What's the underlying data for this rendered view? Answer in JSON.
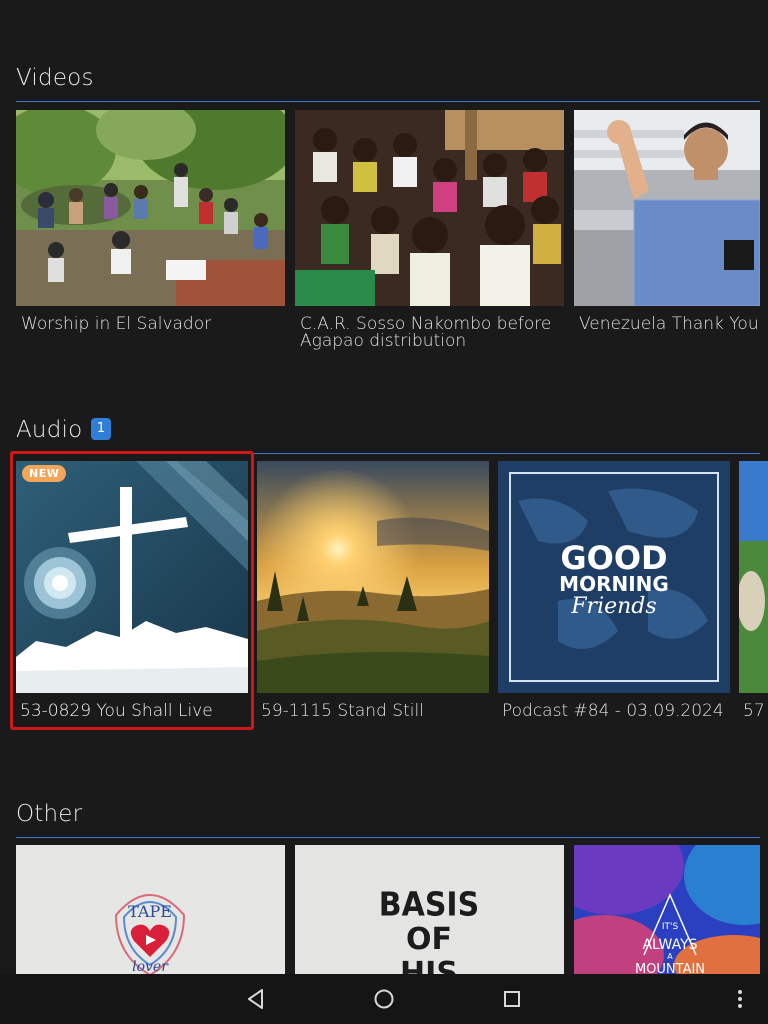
{
  "sections": {
    "videos": {
      "title": "Videos",
      "items": [
        {
          "title": "Worship in El Salvador"
        },
        {
          "title": "C.A.R. Sosso Nakombo before Agapao distribution"
        },
        {
          "title": "Venezuela Thank You"
        }
      ]
    },
    "audio": {
      "title": "Audio",
      "badge": "1",
      "items": [
        {
          "title": "53-0829 You Shall Live",
          "new_label": "NEW"
        },
        {
          "title": "59-1115 Stand Still"
        },
        {
          "title": "Podcast #84 - 03.09.2024",
          "art_line1": "GOOD",
          "art_line2": "MORNING",
          "art_line3": "Friends"
        },
        {
          "title": "57"
        }
      ]
    },
    "other": {
      "title": "Other",
      "items": [
        {
          "art_line1": "TAPE",
          "art_line2": "lover"
        },
        {
          "art_line1": "BASIS",
          "art_line2": "OF",
          "art_line3": "HIS"
        },
        {
          "art_line1": "IT'S",
          "art_line2": "ALWAYS",
          "art_line3": "A",
          "art_line4": "MOUNTAIN"
        }
      ]
    }
  },
  "colors": {
    "background": "#1a1a1a",
    "accent_line": "#3a7bd5",
    "badge": "#2f7fd8",
    "focus": "#d01818",
    "new_badge": "#f2a65a"
  },
  "navbar": {
    "icons": [
      "back-icon",
      "home-icon",
      "recents-icon",
      "more-vert-icon"
    ]
  }
}
